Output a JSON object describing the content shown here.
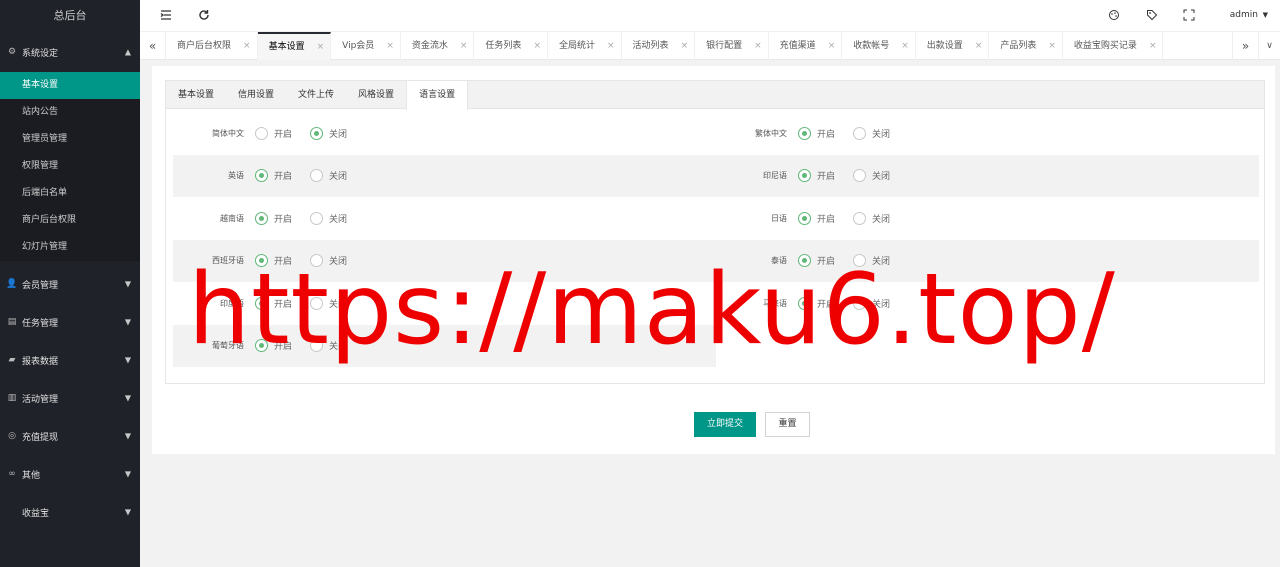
{
  "sidebar": {
    "logo": "总后台",
    "first_group": {
      "label": "系统设定",
      "icon": "gear-icon"
    },
    "sub_items": [
      {
        "label": "基本设置",
        "active": true
      },
      {
        "label": "站内公告",
        "active": false
      },
      {
        "label": "管理员管理",
        "active": false
      },
      {
        "label": "权限管理",
        "active": false
      },
      {
        "label": "后端白名单",
        "active": false
      },
      {
        "label": "商户后台权限",
        "active": false
      },
      {
        "label": "幻灯片管理",
        "active": false
      }
    ],
    "groups": [
      {
        "label": "会员管理",
        "icon": "user-icon"
      },
      {
        "label": "任务管理",
        "icon": "document-icon"
      },
      {
        "label": "报表数据",
        "icon": "report-icon"
      },
      {
        "label": "活动管理",
        "icon": "activity-icon"
      },
      {
        "label": "充值提现",
        "icon": "coin-icon"
      },
      {
        "label": "其他",
        "icon": "link-icon"
      },
      {
        "label": "收益宝",
        "icon": ""
      }
    ]
  },
  "header": {
    "user": "admin"
  },
  "tabs": [
    {
      "label": "商户后台权限",
      "active": false
    },
    {
      "label": "基本设置",
      "active": true
    },
    {
      "label": "Vip会员",
      "active": false
    },
    {
      "label": "资金流水",
      "active": false
    },
    {
      "label": "任务列表",
      "active": false
    },
    {
      "label": "全局统计",
      "active": false
    },
    {
      "label": "活动列表",
      "active": false
    },
    {
      "label": "银行配置",
      "active": false
    },
    {
      "label": "充值渠道",
      "active": false
    },
    {
      "label": "收款帐号",
      "active": false
    },
    {
      "label": "出款设置",
      "active": false
    },
    {
      "label": "产品列表",
      "active": false
    },
    {
      "label": "收益宝购买记录",
      "active": false
    }
  ],
  "inner_tabs": [
    {
      "label": "基本设置",
      "active": false
    },
    {
      "label": "信用设置",
      "active": false
    },
    {
      "label": "文件上传",
      "active": false
    },
    {
      "label": "风格设置",
      "active": false
    },
    {
      "label": "语言设置",
      "active": true
    }
  ],
  "radio_labels": {
    "on": "开启",
    "off": "关闭"
  },
  "languages": [
    {
      "label": "简体中文",
      "enabled": false
    },
    {
      "label": "繁体中文",
      "enabled": true
    },
    {
      "label": "英语",
      "enabled": true
    },
    {
      "label": "印尼语",
      "enabled": true
    },
    {
      "label": "越南语",
      "enabled": true
    },
    {
      "label": "日语",
      "enabled": true
    },
    {
      "label": "西班牙语",
      "enabled": true
    },
    {
      "label": "泰语",
      "enabled": true
    },
    {
      "label": "印度语",
      "enabled": true
    },
    {
      "label": "马来语",
      "enabled": true
    },
    {
      "label": "葡萄牙语",
      "enabled": true
    }
  ],
  "buttons": {
    "submit": "立即提交",
    "reset": "重置"
  },
  "watermark": "https://maku6.top/"
}
